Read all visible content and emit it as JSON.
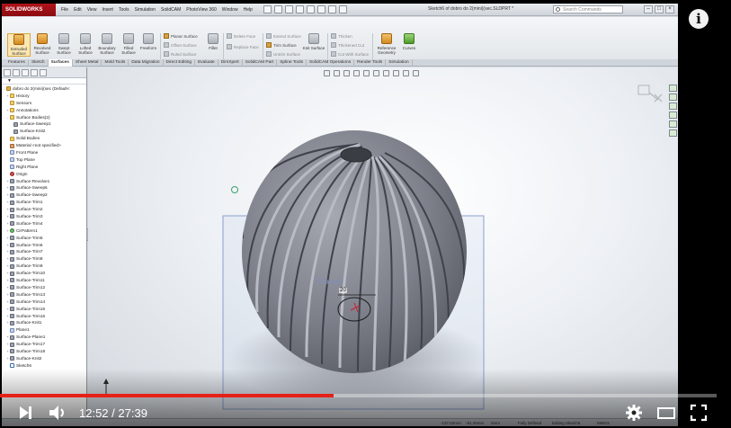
{
  "app": {
    "logo_text": "SOLIDWORKS",
    "document_title": "Sketch6 of dobro do 2(mini)(sec.SLDPRT *",
    "search_placeholder": "Search Commands",
    "menu": [
      "File",
      "Edit",
      "View",
      "Insert",
      "Tools",
      "Simulation",
      "SolidCAM",
      "PhotoView 360",
      "Window",
      "Help"
    ]
  },
  "ribbon": {
    "big_buttons": [
      "Extruded Surface",
      "Revolved Surface",
      "Swept Surface",
      "Lofted Surface",
      "Boundary Surface",
      "Filled Surface",
      "Freeform",
      "Fillet",
      "Knit Surface",
      "Reference Geometry",
      "Curves"
    ],
    "small_buttons": [
      "Planar Surface",
      "Offset Surface",
      "Ruled Surface",
      "Delete Face",
      "Replace Face",
      "Extend Surface",
      "Trim Surface",
      "Untrim Surface",
      "Thicken",
      "Thickened Cut",
      "Cut With Surface"
    ]
  },
  "tabs": [
    "Features",
    "Sketch",
    "Surfaces",
    "Sheet Metal",
    "Mold Tools",
    "Data Migration",
    "Direct Editing",
    "Evaluate",
    "DimXpert",
    "SolidCAM Part",
    "Spline Tools",
    "SolidCAM Operations",
    "Render Tools",
    "Simulation"
  ],
  "active_tab": "Surfaces",
  "tree": {
    "items": [
      {
        "label": "dobro do 2(mini)(sec (Default<",
        "icon": "part-icon",
        "expander": "-"
      },
      {
        "label": "History",
        "icon": "folder-icon",
        "expander": "+"
      },
      {
        "label": "Sensors",
        "icon": "folder-icon",
        "expander": ""
      },
      {
        "label": "Annotations",
        "icon": "folder-icon",
        "expander": "+"
      },
      {
        "label": "Surface Bodies(2)",
        "icon": "folder-icon",
        "expander": "-"
      },
      {
        "label": "Surface-Sweep1",
        "icon": "surface-icon",
        "expander": ""
      },
      {
        "label": "Surface-Knit2",
        "icon": "surface-icon",
        "expander": ""
      },
      {
        "label": "Solid Bodies",
        "icon": "folder-icon",
        "expander": ""
      },
      {
        "label": "Material <not specified>",
        "icon": "material-icon",
        "expander": ""
      },
      {
        "label": "Front Plane",
        "icon": "plane-icon",
        "expander": ""
      },
      {
        "label": "Top Plane",
        "icon": "plane-icon",
        "expander": ""
      },
      {
        "label": "Right Plane",
        "icon": "plane-icon",
        "expander": ""
      },
      {
        "label": "Origin",
        "icon": "origin-icon",
        "expander": ""
      },
      {
        "label": "Surface-Revolve1",
        "icon": "surface-icon",
        "expander": "+"
      },
      {
        "label": "Surface-Sweep6",
        "icon": "surface-icon",
        "expander": "+"
      },
      {
        "label": "Surface-Sweep2",
        "icon": "surface-icon",
        "expander": "+"
      },
      {
        "label": "Surface-Trim1",
        "icon": "surface-icon",
        "expander": "+"
      },
      {
        "label": "Surface-Trim2",
        "icon": "surface-icon",
        "expander": "+"
      },
      {
        "label": "Surface-Trim3",
        "icon": "surface-icon",
        "expander": "+"
      },
      {
        "label": "Surface-Trim4",
        "icon": "surface-icon",
        "expander": "+"
      },
      {
        "label": "CirPattern1",
        "icon": "pattern-icon",
        "expander": "+"
      },
      {
        "label": "Surface-Trim5",
        "icon": "surface-icon",
        "expander": "+"
      },
      {
        "label": "Surface-Trim6",
        "icon": "surface-icon",
        "expander": "+"
      },
      {
        "label": "Surface-Trim7",
        "icon": "surface-icon",
        "expander": "+"
      },
      {
        "label": "Surface-Trim8",
        "icon": "surface-icon",
        "expander": "+"
      },
      {
        "label": "Surface-Trim9",
        "icon": "surface-icon",
        "expander": "+"
      },
      {
        "label": "Surface-Trim10",
        "icon": "surface-icon",
        "expander": "+"
      },
      {
        "label": "Surface-Trim11",
        "icon": "surface-icon",
        "expander": "+"
      },
      {
        "label": "Surface-Trim12",
        "icon": "surface-icon",
        "expander": "+"
      },
      {
        "label": "Surface-Trim13",
        "icon": "surface-icon",
        "expander": "+"
      },
      {
        "label": "Surface-Trim14",
        "icon": "surface-icon",
        "expander": "+"
      },
      {
        "label": "Surface-Trim15",
        "icon": "surface-icon",
        "expander": "+"
      },
      {
        "label": "Surface-Trim16",
        "icon": "surface-icon",
        "expander": "+"
      },
      {
        "label": "Surface-Knit1",
        "icon": "surface-icon",
        "expander": "+"
      },
      {
        "label": "Plane1",
        "icon": "plane-icon",
        "expander": ""
      },
      {
        "label": "Surface-Plane1",
        "icon": "surface-icon",
        "expander": "+"
      },
      {
        "label": "Surface-Trim17",
        "icon": "surface-icon",
        "expander": "+"
      },
      {
        "label": "Surface-Trim18",
        "icon": "surface-icon",
        "expander": "+"
      },
      {
        "label": "Surface-Knit2",
        "icon": "surface-icon",
        "expander": "+"
      },
      {
        "label": "Sketch6",
        "icon": "sketch-icon",
        "expander": ""
      }
    ]
  },
  "viewport": {
    "plane_label": "Plane1",
    "dimension_value": "20"
  },
  "statusbar": {
    "coords": "-137.62mm",
    "y": "-81.25mm",
    "z": "0mm",
    "state": "Fully Defined",
    "editing": "Editing Sketch6",
    "units": "MMGS"
  },
  "player": {
    "current_time": "12:52",
    "separator": " / ",
    "duration": "27:39",
    "progress_fraction": 0.465,
    "info_icon": "info-icon"
  },
  "colors": {
    "solidworks_red": "#b0121a",
    "progress_red": "#e62117",
    "model_gray": "#7c7f88"
  }
}
